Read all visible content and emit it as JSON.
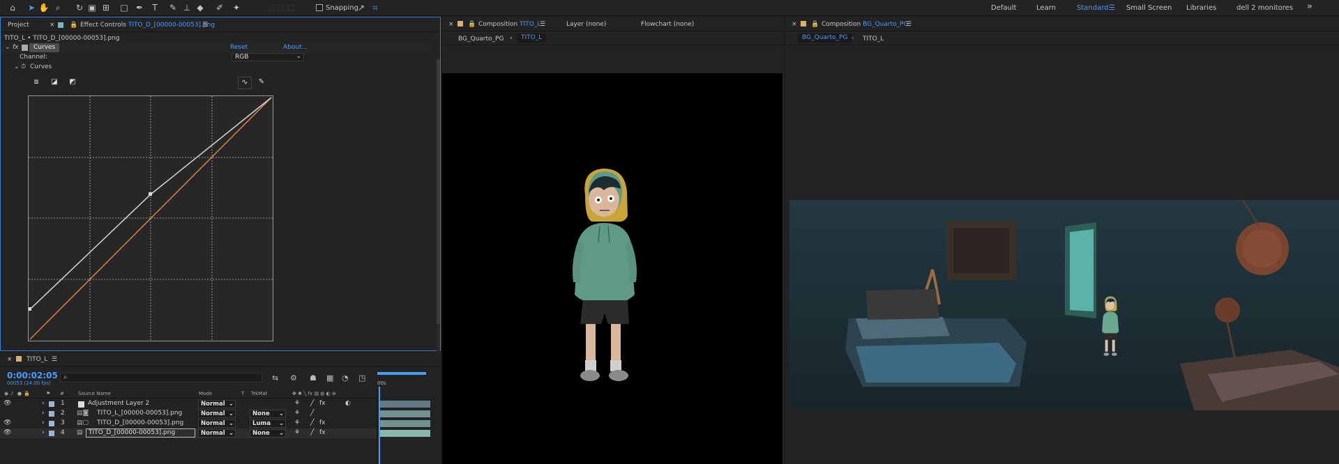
{
  "toolbar": {
    "tools": [
      "home-icon",
      "selection-arrow-icon",
      "hand-icon",
      "zoom-icon",
      "rotate-icon",
      "camera-icon",
      "pan-behind-icon",
      "rectangle-icon",
      "pen-icon",
      "type-icon",
      "brush-icon",
      "clone-stamp-icon",
      "eraser-icon",
      "roto-brush-icon",
      "puppet-pin-icon"
    ],
    "snapping_label": "Snapping",
    "snapping_checked": false
  },
  "workspaces": {
    "items": [
      "Default",
      "Learn",
      "Standard",
      "Small Screen",
      "Libraries",
      "dell 2 monitores"
    ],
    "active": "Standard",
    "more_label": "»"
  },
  "project_panel": {
    "tab_label": "Project"
  },
  "effect_controls": {
    "tab_prefix": "Effect Controls",
    "tab_layer": "TITO_D_[00000-00053].png",
    "breadcrumb": "TITO_L • TITO_D_[00000-00053].png",
    "effect_name": "Curves",
    "reset_label": "Reset",
    "about_label": "About...",
    "channel_label": "Channel:",
    "channel_value": "RGB",
    "curves_label": "Curves",
    "fx_label": "fx",
    "curve_color_white": "#d8d8d8",
    "curve_color_orange": "#e0803a"
  },
  "comp_tito": {
    "tab_prefix": "Composition",
    "tab_name": "TITO_L",
    "layer_tab": "Layer (none)",
    "flowchart_tab": "Flowchart (none)",
    "crumb_1": "BG_Quarto_PG",
    "crumb_2": "TITO_L"
  },
  "comp_bg": {
    "tab_prefix": "Composition",
    "tab_name": "BG_Quarto_PG",
    "crumb_1": "BG_Quarto_PG",
    "crumb_2": "TITO_L"
  },
  "timeline": {
    "tab_name": "TITO_L",
    "timecode": "0:00:02:05",
    "frame_info": "00053 (24.00 fps)",
    "search_placeholder": "",
    "col_number": "#",
    "col_source": "Source Name",
    "col_mode": "Mode",
    "col_t": "T",
    "col_trkmat": "TrkMat",
    "ruler_label": "00s",
    "layers": [
      {
        "num": "1",
        "name": "Adjustment Layer 2",
        "mode": "Normal",
        "trkmat": ""
      },
      {
        "num": "2",
        "name": "TITO_L_[00000-00053].png",
        "mode": "Normal",
        "trkmat": "None"
      },
      {
        "num": "3",
        "name": "TITO_D_[00000-00053].png",
        "mode": "Normal",
        "trkmat": "Luma"
      },
      {
        "num": "4",
        "name": "TITO_D_[00000-00053].png",
        "mode": "Normal",
        "trkmat": "None"
      }
    ]
  },
  "colors": {
    "accent": "#4a9bff",
    "panel": "#232323",
    "bg": "#1e1e1e",
    "hoodie": "#5f9a86",
    "hood_outline": "#c9a437",
    "shorts": "#2b2b2b",
    "skin": "#d9b79a"
  }
}
